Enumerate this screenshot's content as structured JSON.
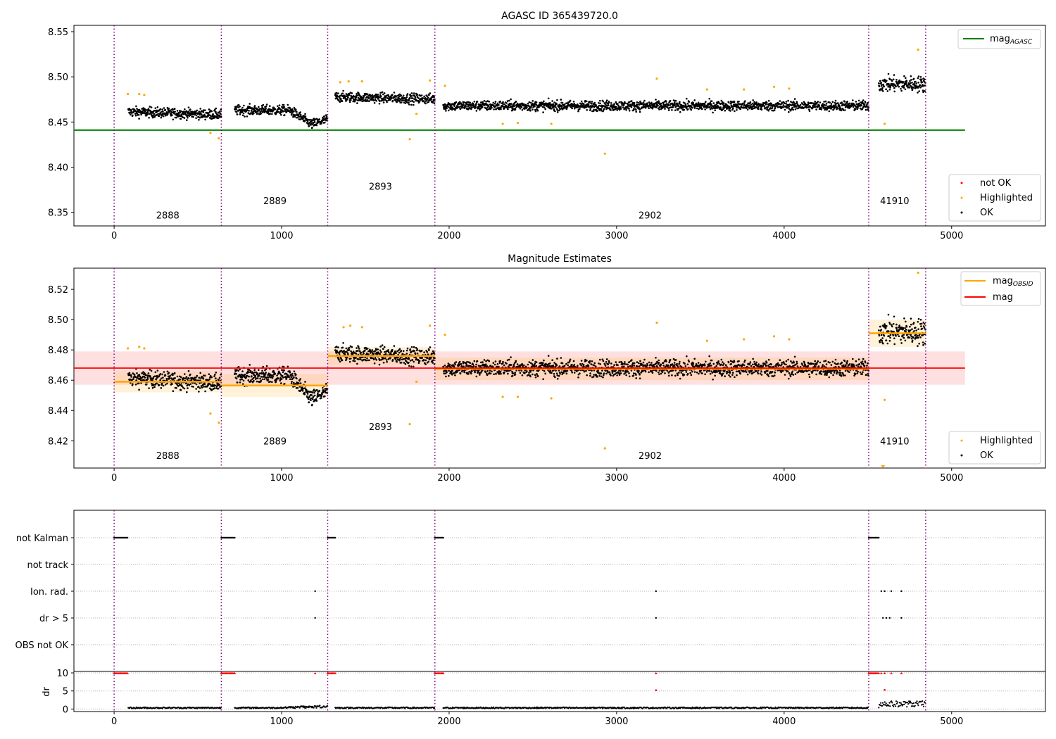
{
  "chart_data": [
    {
      "type": "scatter",
      "title": "AGASC ID 365439720.0",
      "xlim": [
        -240,
        5560
      ],
      "ylim": [
        8.335,
        8.557
      ],
      "xticks": [
        0,
        1000,
        2000,
        3000,
        4000,
        5000
      ],
      "yticks": [
        8.35,
        8.4,
        8.45,
        8.5,
        8.55
      ],
      "ytick_labels": [
        "8.35",
        "8.40",
        "8.45",
        "8.50",
        "8.55"
      ],
      "lines": [
        {
          "name": "mag",
          "subscript": "AGASC",
          "color": "#008000",
          "x": [
            -240,
            5080
          ],
          "y": [
            8.441,
            8.441
          ]
        }
      ],
      "legend_top": [
        {
          "name": "mag",
          "subscript": "AGASC",
          "color": "#008000"
        }
      ],
      "legend_bottom": [
        {
          "name": "not OK",
          "color": "#ff0000"
        },
        {
          "name": "Highlighted",
          "color": "#ffa500"
        },
        {
          "name": "OK",
          "color": "#000000"
        }
      ],
      "obsid_labels": [
        {
          "text": "2888",
          "x": 320,
          "y": 8.343
        },
        {
          "text": "2889",
          "x": 960,
          "y": 8.359
        },
        {
          "text": "2893",
          "x": 1590,
          "y": 8.375
        },
        {
          "text": "2902",
          "x": 3200,
          "y": 8.343
        },
        {
          "text": "41910",
          "x": 4660,
          "y": 8.359
        }
      ],
      "highlighted_points": [
        {
          "x": 82,
          "y": 8.481
        },
        {
          "x": 150,
          "y": 8.481
        },
        {
          "x": 180,
          "y": 8.48
        },
        {
          "x": 575,
          "y": 8.438
        },
        {
          "x": 625,
          "y": 8.432
        },
        {
          "x": 1350,
          "y": 8.494
        },
        {
          "x": 1400,
          "y": 8.495
        },
        {
          "x": 1480,
          "y": 8.495
        },
        {
          "x": 1765,
          "y": 8.431
        },
        {
          "x": 1805,
          "y": 8.459
        },
        {
          "x": 1885,
          "y": 8.496
        },
        {
          "x": 1975,
          "y": 8.49
        },
        {
          "x": 2320,
          "y": 8.448
        },
        {
          "x": 2410,
          "y": 8.449
        },
        {
          "x": 2610,
          "y": 8.448
        },
        {
          "x": 2930,
          "y": 8.415
        },
        {
          "x": 3240,
          "y": 8.498
        },
        {
          "x": 3540,
          "y": 8.486
        },
        {
          "x": 3760,
          "y": 8.486
        },
        {
          "x": 3940,
          "y": 8.489
        },
        {
          "x": 4030,
          "y": 8.487
        },
        {
          "x": 4600,
          "y": 8.448
        },
        {
          "x": 4800,
          "y": 8.53
        }
      ]
    },
    {
      "type": "scatter",
      "title": "Magnitude Estimates",
      "xlim": [
        -240,
        5560
      ],
      "ylim": [
        8.402,
        8.534
      ],
      "xticks": [
        0,
        1000,
        2000,
        3000,
        4000,
        5000
      ],
      "yticks": [
        8.42,
        8.44,
        8.46,
        8.48,
        8.5,
        8.52
      ],
      "ytick_labels": [
        "8.42",
        "8.44",
        "8.46",
        "8.48",
        "8.50",
        "8.52"
      ],
      "mag_line": {
        "name": "mag",
        "color": "#ff0000",
        "y": 8.468,
        "band": [
          8.457,
          8.479
        ],
        "x": [
          -240,
          5080
        ]
      },
      "obsid_levels": [
        {
          "x0": 0,
          "x1": 640,
          "y": 8.459,
          "band": [
            8.452,
            8.466
          ]
        },
        {
          "x0": 640,
          "x1": 1275,
          "y": 8.4565,
          "band": [
            8.449,
            8.464
          ]
        },
        {
          "x0": 1275,
          "x1": 1915,
          "y": 8.476,
          "band": [
            8.47,
            8.482
          ]
        },
        {
          "x0": 1915,
          "x1": 4505,
          "y": 8.4675,
          "band": [
            8.46,
            8.475
          ]
        },
        {
          "x0": 4505,
          "x1": 4845,
          "y": 8.491,
          "band": [
            8.482,
            8.5
          ]
        }
      ],
      "legend_top": [
        {
          "name": "mag",
          "subscript": "OBSID",
          "color": "#ffa500"
        },
        {
          "name": "mag",
          "subscript": "",
          "color": "#ff0000"
        }
      ],
      "legend_bottom": [
        {
          "name": "Highlighted",
          "color": "#ffa500"
        },
        {
          "name": "OK",
          "color": "#000000"
        }
      ],
      "obsid_labels": [
        {
          "text": "2888",
          "x": 320,
          "y": 8.408
        },
        {
          "text": "2889",
          "x": 960,
          "y": 8.4175
        },
        {
          "text": "2893",
          "x": 1590,
          "y": 8.427
        },
        {
          "text": "2902",
          "x": 3200,
          "y": 8.408
        },
        {
          "text": "41910",
          "x": 4660,
          "y": 8.4175
        }
      ],
      "highlighted_points": [
        {
          "x": 82,
          "y": 8.481
        },
        {
          "x": 150,
          "y": 8.482
        },
        {
          "x": 180,
          "y": 8.481
        },
        {
          "x": 575,
          "y": 8.438
        },
        {
          "x": 625,
          "y": 8.432
        },
        {
          "x": 1370,
          "y": 8.495
        },
        {
          "x": 1410,
          "y": 8.496
        },
        {
          "x": 1480,
          "y": 8.495
        },
        {
          "x": 1765,
          "y": 8.431
        },
        {
          "x": 1805,
          "y": 8.459
        },
        {
          "x": 1885,
          "y": 8.496
        },
        {
          "x": 1975,
          "y": 8.49
        },
        {
          "x": 2320,
          "y": 8.449
        },
        {
          "x": 2410,
          "y": 8.449
        },
        {
          "x": 2610,
          "y": 8.448
        },
        {
          "x": 2930,
          "y": 8.415
        },
        {
          "x": 3240,
          "y": 8.498
        },
        {
          "x": 3540,
          "y": 8.486
        },
        {
          "x": 3760,
          "y": 8.487
        },
        {
          "x": 3940,
          "y": 8.489
        },
        {
          "x": 4030,
          "y": 8.487
        },
        {
          "x": 4600,
          "y": 8.447
        },
        {
          "x": 4800,
          "y": 8.531
        }
      ],
      "offscale_markers": [
        {
          "x": 4590,
          "y": 8.402
        }
      ]
    },
    {
      "type": "scatter",
      "title": "",
      "xlim": [
        -240,
        5560
      ],
      "categories": [
        "not Kalman",
        "not track",
        "Ion. rad.",
        "dr > 5",
        "OBS not OK"
      ],
      "flag_events": {
        "not Kalman": [
          [
            0,
            80
          ],
          [
            640,
            720
          ],
          [
            1275,
            1320
          ],
          [
            1915,
            1965
          ],
          [
            4505,
            4565
          ]
        ],
        "not track": [],
        "Ion. rad.": [
          1200,
          3235,
          4580,
          4600,
          4640,
          4700
        ],
        "dr > 5": [
          1200,
          3235,
          4590,
          4610,
          4630,
          4700
        ],
        "OBS not OK": []
      }
    },
    {
      "type": "scatter",
      "title": "",
      "ylabel": "dr",
      "xlim": [
        -240,
        5560
      ],
      "ylim": [
        -0.7,
        10.4
      ],
      "xticks": [
        0,
        1000,
        2000,
        3000,
        4000,
        5000
      ],
      "yticks": [
        0,
        5,
        10
      ],
      "ytick_labels": [
        "0",
        "5",
        "10"
      ],
      "clipped_segments": [
        [
          0,
          80
        ],
        [
          640,
          720
        ],
        [
          1275,
          1320
        ],
        [
          1915,
          1965
        ],
        [
          4505,
          4565
        ]
      ],
      "clipped_points": [
        1200,
        3235,
        4580,
        4600,
        4640,
        4700
      ],
      "mid_points": [
        {
          "x": 3235,
          "y": 5.2
        },
        {
          "x": 4600,
          "y": 5.3
        }
      ]
    }
  ],
  "obsid_boundaries": [
    0,
    640,
    1275,
    1915,
    4505,
    4845
  ]
}
